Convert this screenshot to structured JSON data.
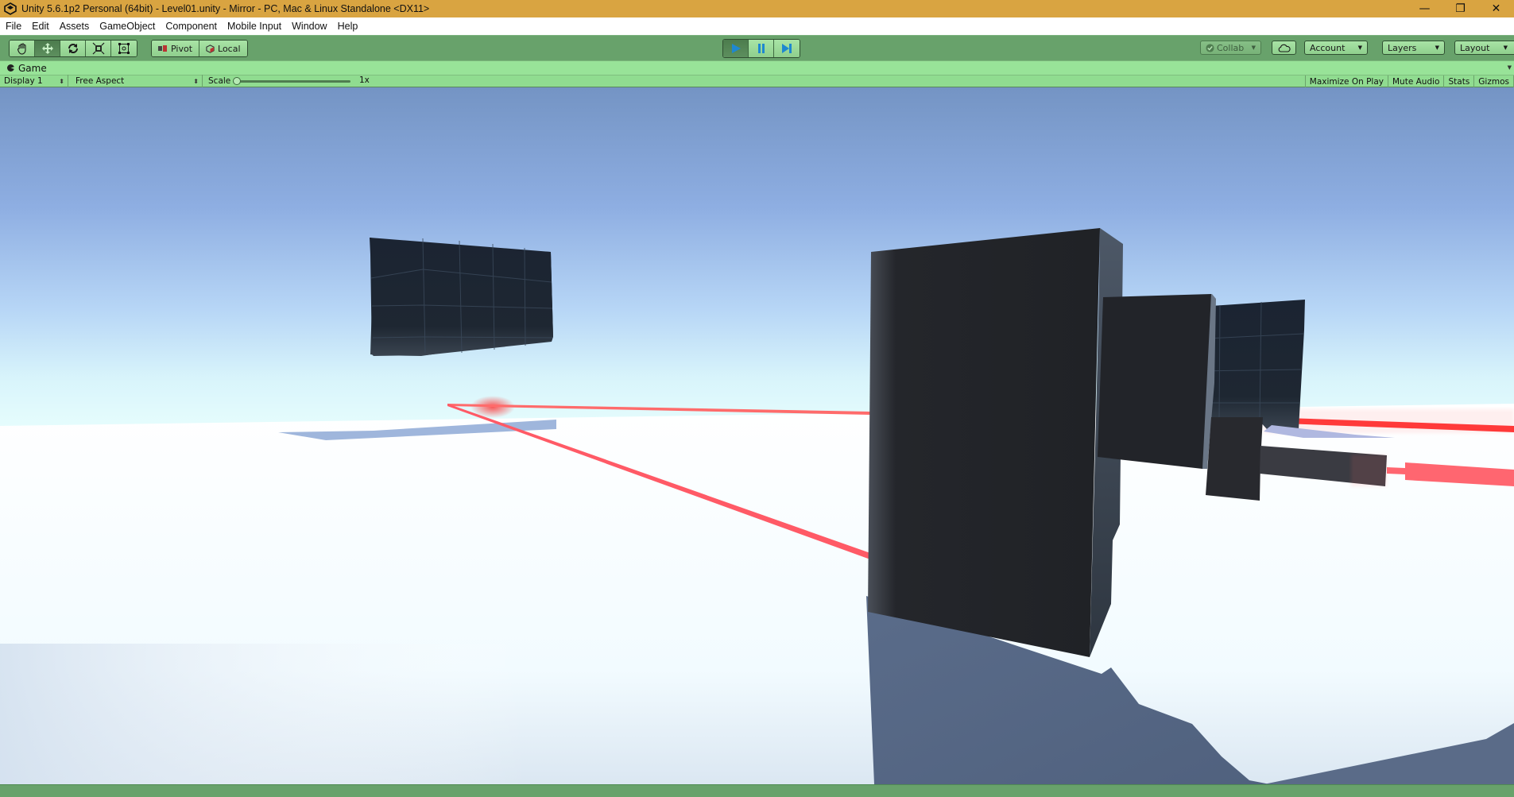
{
  "window": {
    "title": "Unity 5.6.1p2 Personal (64bit) - Level01.unity - Mirror - PC, Mac & Linux Standalone <DX11>",
    "controls": {
      "minimize": "—",
      "restore": "❐",
      "close": "✕"
    }
  },
  "menu": [
    "File",
    "Edit",
    "Assets",
    "GameObject",
    "Component",
    "Mobile Input",
    "Window",
    "Help"
  ],
  "toolbar": {
    "tools": [
      {
        "name": "hand-tool",
        "icon": "✋",
        "active": false
      },
      {
        "name": "move-tool",
        "icon": "✥",
        "active": true
      },
      {
        "name": "rotate-tool",
        "icon": "⟳",
        "active": false
      },
      {
        "name": "scale-tool",
        "icon": "⤡",
        "active": false
      },
      {
        "name": "rect-tool",
        "icon": "⊡",
        "active": false
      }
    ],
    "pivot_label": "Pivot",
    "local_label": "Local",
    "play": {
      "play_icon": "▶",
      "pause_icon": "❚❚",
      "step_icon": "▶❚",
      "playing": true
    },
    "collab_label": "Collab",
    "account_label": "Account",
    "layers_label": "Layers",
    "layout_label": "Layout"
  },
  "game_view": {
    "tab_label": "Game",
    "display_label": "Display 1",
    "aspect_label": "Free Aspect",
    "scale_label": "Scale",
    "scale_value": "1x",
    "toggles": [
      "Maximize On Play",
      "Mute Audio",
      "Stats",
      "Gizmos"
    ]
  },
  "colors": {
    "title_bar": "#d9a441",
    "toolbar_green": "#68a26b",
    "tab_green": "#98e398",
    "play_blue": "#1e88d0",
    "laser_red": "#ff3b3b",
    "cube_dark": "#1d2530"
  }
}
